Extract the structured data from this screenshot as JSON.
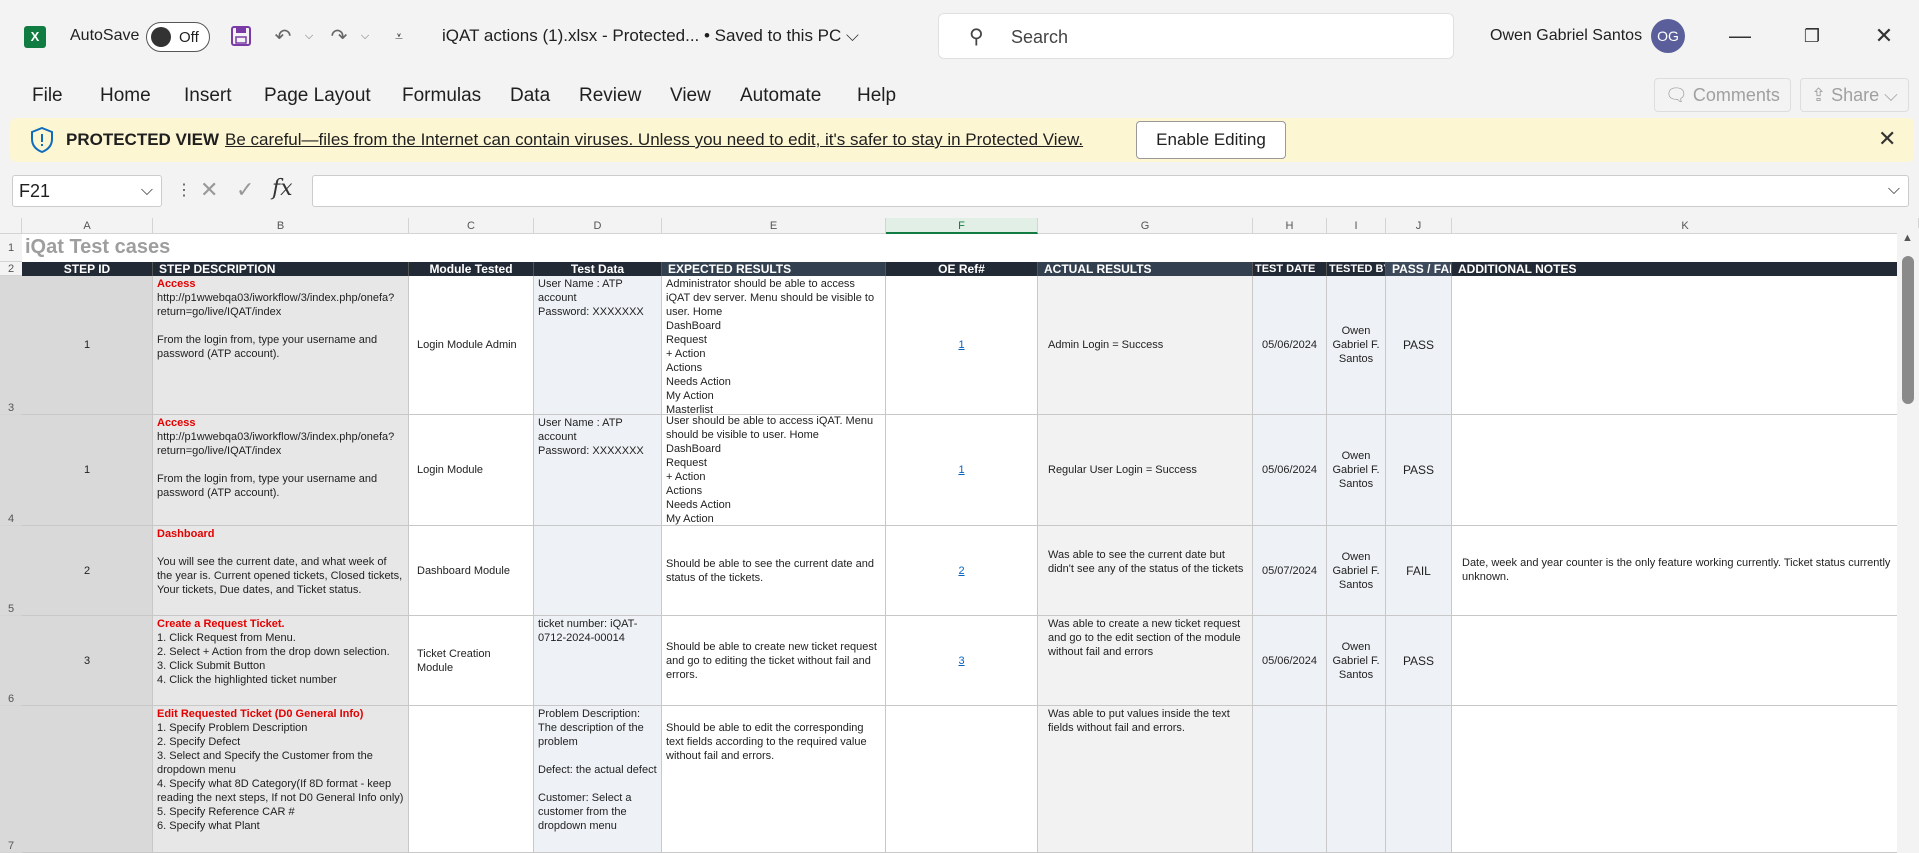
{
  "titlebar": {
    "autosave_label": "AutoSave",
    "autosave_state": "Off",
    "doc_title": "iQAT actions (1).xlsx  -  Protected... • Saved to this PC ⌵",
    "search_placeholder": "Search",
    "user_name": "Owen Gabriel Santos",
    "user_initials": "OG"
  },
  "menu": {
    "items": [
      "File",
      "Home",
      "Insert",
      "Page Layout",
      "Formulas",
      "Data",
      "Review",
      "View",
      "Automate",
      "Help"
    ],
    "comments": "Comments",
    "share": "Share"
  },
  "banner": {
    "title": "PROTECTED VIEW",
    "message": "Be careful—files from the Internet can contain viruses. Unless you need to edit, it's safer to stay in Protected View.",
    "enable_button": "Enable Editing"
  },
  "formula_bar": {
    "name_box": "F21",
    "formula": ""
  },
  "sheet": {
    "title": "iQat Test cases",
    "columns": [
      "A",
      "B",
      "C",
      "D",
      "E",
      "F",
      "G",
      "H",
      "I",
      "J",
      "K"
    ],
    "headers": [
      "STEP ID",
      "STEP DESCRIPTION",
      "Module Tested",
      "Test Data",
      "EXPECTED RESULTS",
      "OE Ref#",
      "ACTUAL RESULTS",
      "TEST DATE",
      "TESTED BY",
      "PASS / FAIL",
      "ADDITIONAL NOTES"
    ],
    "row_numbers": [
      "1",
      "2",
      "3",
      "4",
      "5",
      "6",
      "7"
    ],
    "rows": [
      {
        "id": "1",
        "desc_title": "Access",
        "desc_body": "http://p1wwebqa03/iworkflow/3/index.php/onefa?return=go/live/IQAT/index\n\nFrom the login from, type your username and password (ATP account).",
        "module": "Login Module Admin",
        "test_data": "User Name : ATP account\nPassword: XXXXXXX",
        "expected": "Administrator should be able to access iQAT dev server.  Menu should be visible to user.  Home\nDashBoard\nRequest\n+ Action\nActions\nNeeds Action\nMy Action\nMasterlist",
        "ref": "1",
        "actual": "Admin Login = Success",
        "date": "05/06/2024",
        "tester": "Owen Gabriel F. Santos",
        "result": "PASS",
        "notes": ""
      },
      {
        "id": "1",
        "desc_title": "Access",
        "desc_body": "http://p1wwebqa03/iworkflow/3/index.php/onefa?return=go/live/IQAT/index\n\nFrom the login from, type your username and password (ATP account).",
        "module": "Login Module",
        "test_data": "User Name : ATP account\nPassword: XXXXXXX",
        "expected": "User should be able to access iQAT. Menu should be visible to user.  Home\nDashBoard\nRequest\n+ Action\nActions\nNeeds Action\nMy Action",
        "ref": "1",
        "actual": "Regular User Login = Success",
        "date": "05/06/2024",
        "tester": "Owen Gabriel F. Santos",
        "result": "PASS",
        "notes": ""
      },
      {
        "id": "2",
        "desc_title": "Dashboard",
        "desc_body": "\nYou will see the current date, and what week of the year is. Current opened tickets, Closed tickets, Your tickets, Due dates, and Ticket status.",
        "module": "Dashboard Module",
        "test_data": "",
        "expected": "Should be able to see the current date and status of the tickets.",
        "ref": "2",
        "actual": "Was able to see the current date but didn't see any of the status of the tickets",
        "date": "05/07/2024",
        "tester": "Owen Gabriel F. Santos",
        "result": "FAIL",
        "notes": "Date, week and year counter is the only feature working currently. Ticket status currently unknown."
      },
      {
        "id": "3",
        "desc_title": "Create a Request Ticket.",
        "desc_body": "1. Click Request from Menu.\n2. Select + Action from the drop down selection.\n3. Click Submit Button\n4. Click the highlighted ticket number",
        "module": "Ticket Creation Module",
        "test_data": "ticket number: iQAT-0712-2024-00014",
        "expected": "Should be able to create new ticket request and go to editing the ticket without fail and errors.",
        "ref": "3",
        "actual": "Was able to create a new ticket request and go to the edit section of the module without fail and errors",
        "date": "05/06/2024",
        "tester": "Owen Gabriel F. Santos",
        "result": "PASS",
        "notes": ""
      },
      {
        "id": "",
        "desc_title": "Edit Requested Ticket (D0 General Info)",
        "desc_body": "1. Specify Problem Description\n2. Specify Defect\n3. Select and Specify the Customer from the dropdown menu\n4. Specify what 8D Category(If 8D format - keep reading the next steps, If not D0 General Info only)\n5. Specify Reference CAR #\n6. Specify what Plant",
        "module": "",
        "test_data": "Problem Description: The description of the problem\n\nDefect: the actual defect\n\nCustomer: Select a customer from the dropdown menu",
        "expected": "\nShould be able to edit the corresponding text fields according to the required value without fail and errors.",
        "ref": "",
        "actual": "Was able to put values inside the text fields without fail and errors.",
        "date": "",
        "tester": "",
        "result": "",
        "notes": ""
      }
    ]
  }
}
